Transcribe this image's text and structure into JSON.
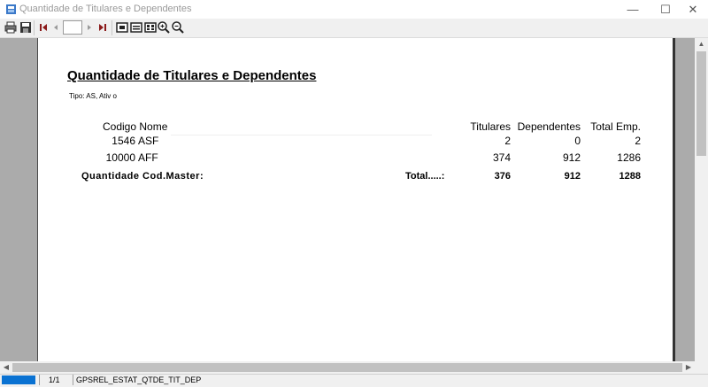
{
  "window": {
    "title": "Quantidade de Titulares e Dependentes",
    "minimize_glyph": "—",
    "maximize_glyph": "☐",
    "close_glyph": "✕"
  },
  "toolbar": {
    "page_value": "",
    "icons": [
      "print-icon",
      "save-icon",
      "first-page-icon",
      "prev-page-icon",
      "next-page-icon",
      "last-page-icon",
      "whole-page-icon",
      "page-width-icon",
      "multi-page-icon",
      "zoom-in-icon",
      "zoom-out-icon"
    ]
  },
  "report": {
    "title": "Quantidade de Titulares e Dependentes",
    "subtitle": "Tipo: AS, Ativ o",
    "headers": {
      "code_name": "Codigo Nome",
      "titulares": "Titulares",
      "dependentes": "Dependentes",
      "total_emp": "Total Emp."
    },
    "rows": [
      {
        "code": "1546",
        "name": "ASF",
        "titulares": "2",
        "dependentes": "0",
        "total": "2"
      },
      {
        "code": "10000",
        "name": "AFF",
        "titulares": "374",
        "dependentes": "912",
        "total": "1286"
      }
    ],
    "totals": {
      "label": "Quantidade Cod.Master:",
      "total_label": "Total.....:",
      "titulares": "376",
      "dependentes": "912",
      "total": "1288"
    }
  },
  "status": {
    "page": "1/1",
    "report_name": "GPSREL_ESTAT_QTDE_TIT_DEP"
  },
  "colors": {
    "progress": "#0a72d2",
    "preview_bg": "#ababab"
  }
}
